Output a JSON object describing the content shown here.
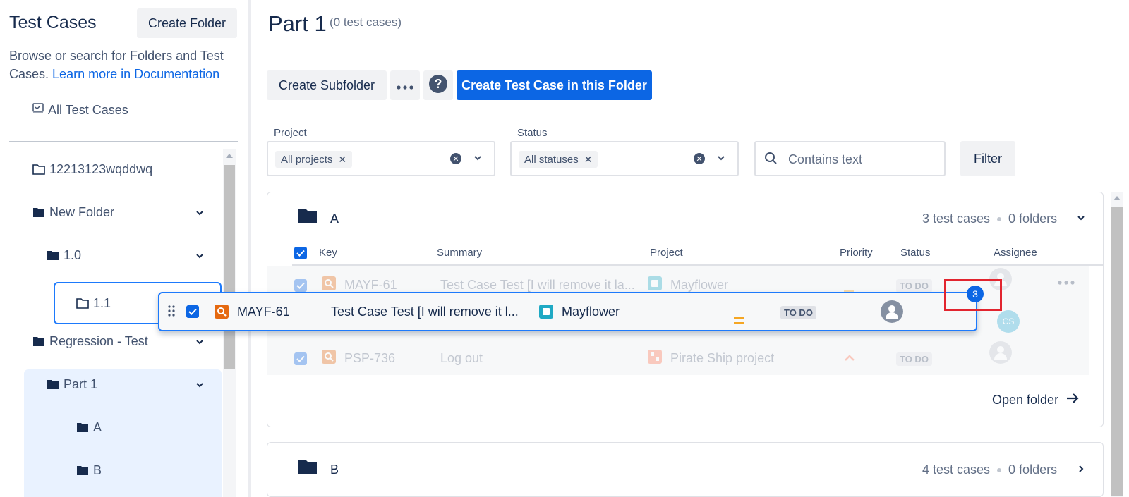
{
  "left_panel": {
    "title": "Test Cases",
    "create_folder_label": "Create Folder",
    "description_text": "Browse or search for Folders and Test Cases.",
    "documentation_link": "Learn more in Documentation",
    "all_test_cases_label": "All Test Cases",
    "tree": [
      {
        "label": "12213123wqddwq",
        "expanded": null,
        "icon": "folder-outline-icon"
      },
      {
        "label": "New Folder",
        "expanded": true,
        "icon": "folder-filled-icon"
      },
      {
        "label": "1.0",
        "expanded": true,
        "icon": "folder-filled-icon"
      },
      {
        "label": "1.1",
        "expanded": null,
        "icon": "folder-outline-icon"
      },
      {
        "label": "Regression - Test",
        "expanded": true,
        "icon": "folder-filled-icon"
      },
      {
        "label": "Part 1",
        "expanded": true,
        "icon": "folder-filled-icon",
        "selected": true
      },
      {
        "label": "A",
        "expanded": null,
        "icon": "folder-filled-icon"
      },
      {
        "label": "B",
        "expanded": null,
        "icon": "folder-filled-icon"
      }
    ]
  },
  "main": {
    "title": "Part 1",
    "count_text": "(0 test cases)",
    "toolbar": {
      "create_subfolder_label": "Create Subfolder",
      "more_label": "•••",
      "help_label": "?",
      "create_test_case_label": "Create Test Case in this Folder"
    },
    "filters": {
      "project_label": "Project",
      "project_chip": "All projects",
      "status_label": "Status",
      "status_chip": "All statuses",
      "search_placeholder": "Contains text",
      "filter_label": "Filter"
    },
    "folder_a": {
      "name": "A",
      "test_cases": "3 test cases",
      "folders": "0 folders",
      "columns": [
        "Key",
        "Summary",
        "Project",
        "Priority",
        "Status",
        "Assignee"
      ],
      "rows": [
        {
          "key": "MAYF-61",
          "summary": "Test Case Test [I will remove it la...",
          "project": "Mayflower",
          "priority": "medium",
          "status": "TO DO",
          "assignee": ""
        },
        {
          "key": "",
          "summary": "",
          "project": "",
          "priority": "",
          "status": "",
          "assignee": "CS"
        },
        {
          "key": "PSP-736",
          "summary": "Log out",
          "project": "Pirate Ship project",
          "priority": "high",
          "status": "TO DO",
          "assignee": ""
        }
      ],
      "open_folder_label": "Open folder"
    },
    "folder_b": {
      "name": "B",
      "test_cases": "4 test cases",
      "folders": "0 folders"
    },
    "drag_preview": {
      "key": "MAYF-61",
      "summary": "Test Case Test [I will remove it l...",
      "project": "Mayflower",
      "status": "TO DO",
      "drag_count": "3"
    }
  },
  "colors": {
    "primary": "#0c66e4",
    "selected_bg": "#e9f2ff",
    "highlight_box": "#e2252f",
    "folder_icon": "#172b4d",
    "priority_medium": "#f5a623",
    "priority_high": "#ff7452",
    "testcase_icon": "#e56910",
    "project_icon": "#1fa9c4"
  }
}
